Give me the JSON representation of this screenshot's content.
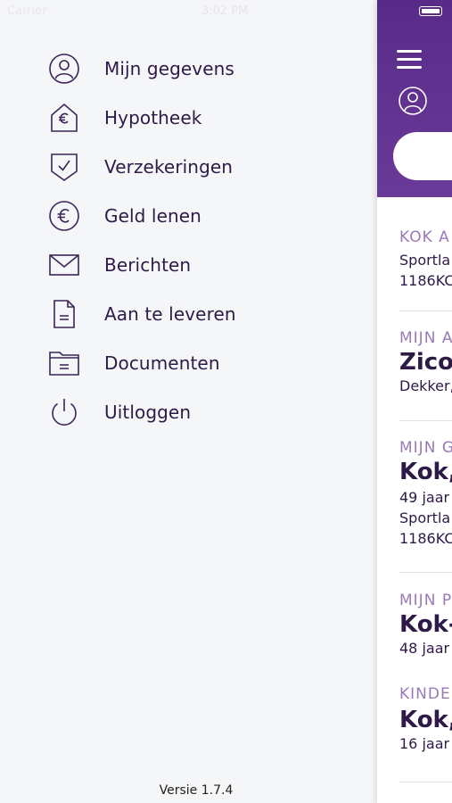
{
  "status_bar": {
    "carrier": "Carrier",
    "time": "3:02 PM"
  },
  "menu": {
    "items": [
      {
        "label": "Mijn gegevens",
        "icon": "user-icon"
      },
      {
        "label": "Hypotheek",
        "icon": "house-euro-icon"
      },
      {
        "label": "Verzekeringen",
        "icon": "shield-check-icon"
      },
      {
        "label": "Geld lenen",
        "icon": "euro-circle-icon"
      },
      {
        "label": "Berichten",
        "icon": "envelope-icon"
      },
      {
        "label": "Aan te leveren",
        "icon": "document-icon"
      },
      {
        "label": "Documenten",
        "icon": "folder-icon"
      },
      {
        "label": "Uitloggen",
        "icon": "power-icon"
      }
    ]
  },
  "version": "Versie 1.7.4",
  "main": {
    "address": {
      "heading": "KOK A",
      "line1": "Sportla",
      "line2": "1186KC"
    },
    "advisor": {
      "heading": "MIJN A",
      "name": "Zico",
      "detail": "Dekker,"
    },
    "customer": {
      "heading": "MIJN G",
      "name": "Kok,",
      "age": "49 jaar",
      "line1": "Sportla",
      "line2": "1186KC"
    },
    "partner": {
      "heading": "MIJN P",
      "name": "Kok-",
      "age": "48 jaar"
    },
    "children": {
      "heading": "KINDE",
      "name": "Kok,",
      "age": "16 jaar -"
    }
  },
  "colors": {
    "brand_purple": "#5a2a88",
    "text_dark": "#2e1a47",
    "heading_light": "#9a7ab8"
  }
}
